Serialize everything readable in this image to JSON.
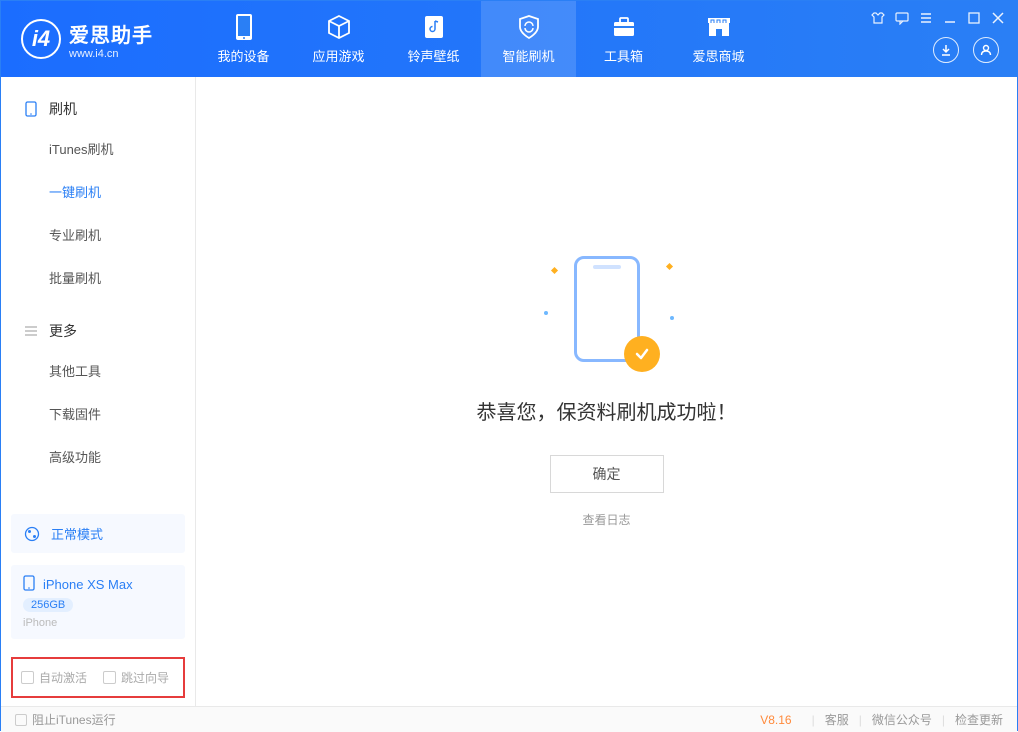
{
  "app": {
    "name": "爱思助手",
    "url": "www.i4.cn"
  },
  "nav": {
    "tabs": [
      {
        "label": "我的设备"
      },
      {
        "label": "应用游戏"
      },
      {
        "label": "铃声壁纸"
      },
      {
        "label": "智能刷机"
      },
      {
        "label": "工具箱"
      },
      {
        "label": "爱思商城"
      }
    ]
  },
  "sidebar": {
    "sections": [
      {
        "title": "刷机",
        "items": [
          {
            "label": "iTunes刷机"
          },
          {
            "label": "一键刷机"
          },
          {
            "label": "专业刷机"
          },
          {
            "label": "批量刷机"
          }
        ]
      },
      {
        "title": "更多",
        "items": [
          {
            "label": "其他工具"
          },
          {
            "label": "下载固件"
          },
          {
            "label": "高级功能"
          }
        ]
      }
    ],
    "mode": "正常模式",
    "device": {
      "name": "iPhone XS Max",
      "storage": "256GB",
      "type": "iPhone"
    },
    "checkboxes": [
      {
        "label": "自动激活"
      },
      {
        "label": "跳过向导"
      }
    ]
  },
  "main": {
    "title": "恭喜您，保资料刷机成功啦！",
    "confirm": "确定",
    "view_log": "查看日志"
  },
  "footer": {
    "block_itunes": "阻止iTunes运行",
    "version": "V8.16",
    "links": [
      "客服",
      "微信公众号",
      "检查更新"
    ]
  }
}
